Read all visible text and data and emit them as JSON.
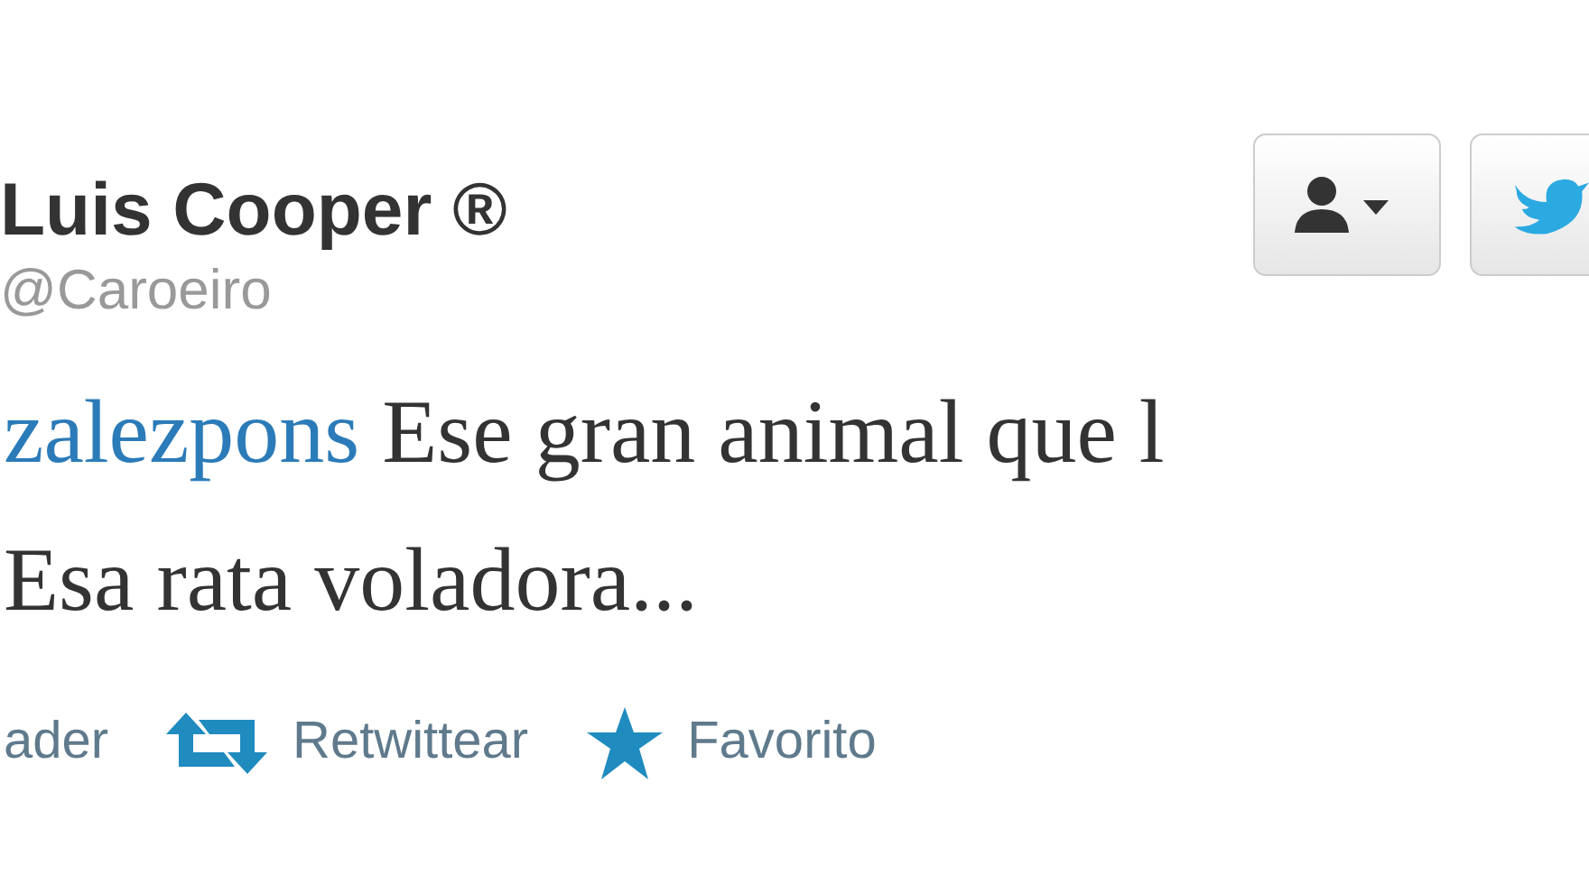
{
  "author": {
    "name": "Luis Cooper ®",
    "handle": "@Caroeiro"
  },
  "tweet": {
    "mention": "zalezpons",
    "lines": [
      "Ese gran animal que l",
      "Esa rata voladora..."
    ]
  },
  "actions": [
    {
      "kind": "reply",
      "label": "ader"
    },
    {
      "kind": "retweet",
      "label": "Retwittear"
    },
    {
      "kind": "favorite",
      "label": "Favorito"
    }
  ]
}
